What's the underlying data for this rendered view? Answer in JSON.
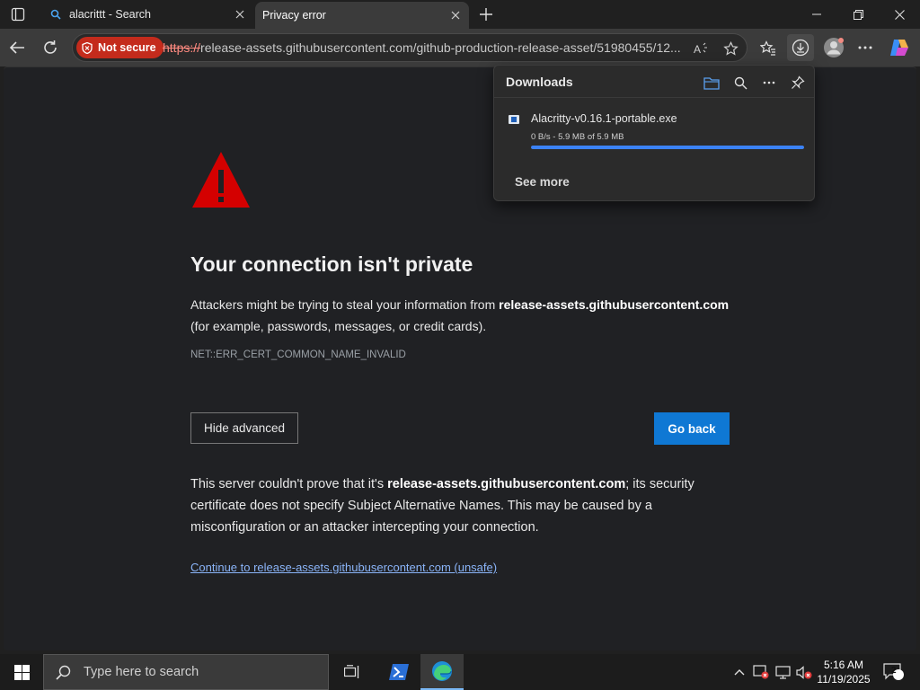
{
  "browser": {
    "tabs": [
      {
        "title": "alacrittt - Search"
      },
      {
        "title": "Privacy error"
      }
    ],
    "address": {
      "security_label": "Not secure",
      "url_scheme": "https://",
      "url_rest": "release-assets.githubusercontent.com/github-production-release-asset/51980455/12..."
    }
  },
  "downloads": {
    "title": "Downloads",
    "items": [
      {
        "name": "Alacritty-v0.16.1-portable.exe",
        "status": "0 B/s - 5.9 MB of 5.9 MB",
        "progress_percent": 100
      }
    ],
    "see_more": "See more"
  },
  "page": {
    "heading": "Your connection isn't private",
    "intro_before": "Attackers might be trying to steal your information from ",
    "intro_host": "release-assets.githubusercontent.com",
    "intro_after": " (for example, passwords, messages, or credit cards).",
    "error_code": "NET::ERR_CERT_COMMON_NAME_INVALID",
    "hide_advanced": "Hide advanced",
    "go_back": "Go back",
    "detail_before": "This server couldn't prove that it's ",
    "detail_host": "release-assets.githubusercontent.com",
    "detail_after": "; its security certificate does not specify Subject Alternative Names. This may be caused by a misconfiguration or an attacker intercepting your connection.",
    "continue_link": "Continue to release-assets.githubusercontent.com (unsafe)"
  },
  "taskbar": {
    "search_placeholder": "Type here to search",
    "time": "5:16 AM",
    "date": "11/19/2025",
    "notification_count": "2"
  },
  "colors": {
    "warning_red": "#d40000",
    "not_secure_badge": "#c42b1c",
    "go_back_button": "#0f78d4",
    "link": "#8ab4f8",
    "progress": "#3b82f6"
  }
}
